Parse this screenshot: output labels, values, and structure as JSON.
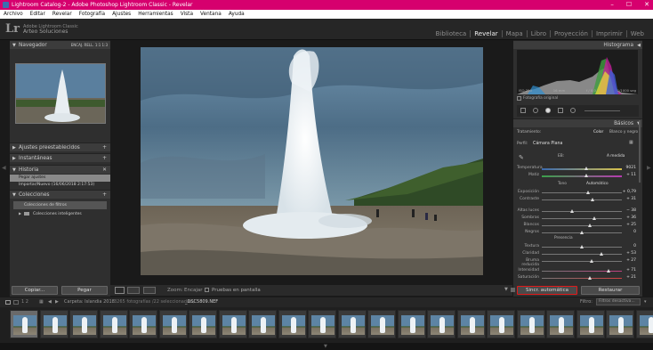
{
  "window": {
    "title": "Lightroom Catalog-2 - Adobe Photoshop Lightroom Classic - Revelar",
    "controls": [
      "–",
      "☐",
      "✕"
    ]
  },
  "menu": [
    "Archivo",
    "Editar",
    "Revelar",
    "Fotografía",
    "Ajustes",
    "Herramientas",
    "Vista",
    "Ventana",
    "Ayuda"
  ],
  "identity": {
    "logo": "Lr",
    "line1": "Adobe Lightroom Classic",
    "line2": "Arteo Soluciones"
  },
  "modules": [
    {
      "label": "Biblioteca"
    },
    {
      "label": "Revelar",
      "active": true
    },
    {
      "label": "Mapa"
    },
    {
      "label": "Libro"
    },
    {
      "label": "Proyección"
    },
    {
      "label": "Imprimir"
    },
    {
      "label": "Web"
    }
  ],
  "left": {
    "navigator": {
      "title": "Navegador",
      "opts": "ENCAJ.  RELL.  1:1  1:3"
    },
    "presets": "Ajustes preestablecidos",
    "snapshots": "Instantáneas",
    "history": {
      "title": "Historia",
      "items": [
        "Pegar ajustes",
        "Importar/Nuevo (16/06/2018 2:17:53)"
      ]
    },
    "collections": {
      "title": "Colecciones",
      "items": [
        "Colecciones de filtros",
        "Colecciones inteligentes"
      ]
    },
    "copy_btn": "Copiar...",
    "paste_btn": "Pegar"
  },
  "toolbar": {
    "zoom_label": "Zoom:",
    "zoom_value": "Encajar",
    "proof": "Pruebas en pantalla"
  },
  "right": {
    "histogram": {
      "title": "Histograma",
      "info": [
        "ISO 250",
        "16 mm",
        "f / 8,0",
        "1/1000 seg"
      ],
      "original": "Fotografía original"
    },
    "basic": {
      "title": "Básicos",
      "treatment": "Tratamiento:",
      "color": "Color",
      "bw": "Blanco y negro",
      "profile_label": "Perfil:",
      "profile_value": "Cámara Plana",
      "wb_label": "EB:",
      "wb_value": "A medida",
      "sliders": [
        {
          "label": "Temperatura",
          "value": "9021",
          "pos": 0.55
        },
        {
          "label": "Matiz",
          "value": "+ 11",
          "pos": 0.55
        },
        {
          "label": "Exposición",
          "value": "+ 0,79",
          "pos": 0.58
        },
        {
          "label": "Contraste",
          "value": "+ 31",
          "pos": 0.63
        },
        {
          "label": "Altas luces",
          "value": "− 38",
          "pos": 0.38
        },
        {
          "label": "Sombras",
          "value": "+ 36",
          "pos": 0.65
        },
        {
          "label": "Blancos",
          "value": "+ 25",
          "pos": 0.6
        },
        {
          "label": "Negros",
          "value": "0",
          "pos": 0.5
        },
        {
          "label": "Textura",
          "value": "0",
          "pos": 0.5
        },
        {
          "label": "Claridad",
          "value": "+ 53",
          "pos": 0.74
        },
        {
          "label": "Bruma reducida",
          "value": "+ 27",
          "pos": 0.62
        },
        {
          "label": "Intensidad",
          "value": "+ 71",
          "pos": 0.83
        },
        {
          "label": "Saturación",
          "value": "+ 21",
          "pos": 0.6
        }
      ],
      "tone": "Tono",
      "auto": "Automático",
      "presence": "Presencia"
    },
    "sync_btn": "Sincr. automática",
    "reset_btn": "Restaurar"
  },
  "filmbar": {
    "pages": "1  2",
    "folder": "Carpeta: Islandia 2018",
    "count": "3265 fotografías /22 seleccionadas /",
    "file": "_DSC5809.NEF",
    "filter_label": "Filtro:",
    "filter_value": "Filtros desactiva..."
  }
}
